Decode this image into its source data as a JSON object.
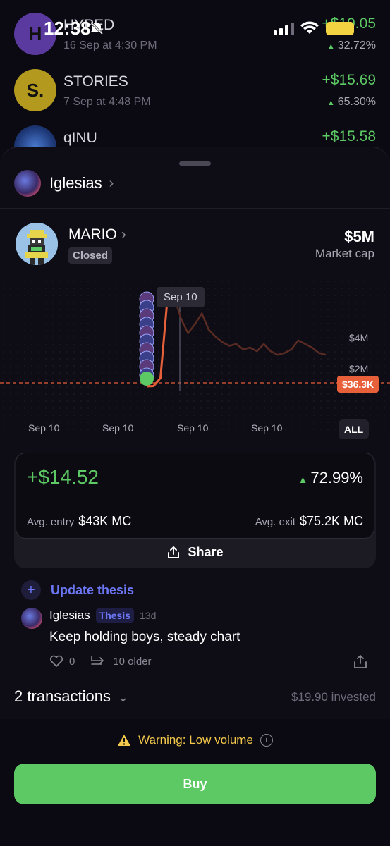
{
  "status_bar": {
    "time": "12:38"
  },
  "background_list": [
    {
      "name": "HYPED",
      "date": "16 Sep at 4:30 PM",
      "amount": "+$19.05",
      "pct": "32.72%",
      "avatar_text": "H",
      "avatar_color": "#5b3aa0"
    },
    {
      "name": "STORIES",
      "date": "7 Sep at 4:48 PM",
      "amount": "+$15.69",
      "pct": "65.30%",
      "avatar_text": "S.",
      "avatar_color": "#b39a1e"
    },
    {
      "name": "qINU",
      "date": "",
      "amount": "+$15.58",
      "pct": "",
      "avatar_text": "",
      "avatar_color": "#1f3a7a"
    }
  ],
  "user": {
    "name": "Iglesias"
  },
  "token": {
    "name": "MARIO",
    "status": "Closed",
    "market_cap": "$5M",
    "market_cap_label": "Market cap"
  },
  "chart_data": {
    "type": "line",
    "tooltip": "Sep 10",
    "x_labels": [
      "Sep 10",
      "Sep 10",
      "Sep 10",
      "Sep 10"
    ],
    "y_labels": [
      "$4M",
      "$2M"
    ],
    "current_price_tag": "$36.3K",
    "range_button": "ALL",
    "series": [
      {
        "values": [
          0.04,
          0.06,
          0.5,
          4.9,
          5.0,
          3.8,
          3.0,
          3.5,
          4.1,
          3.2,
          2.8,
          2.5,
          2.3,
          2.4,
          2.1,
          2.2,
          2.0,
          2.4,
          2.0,
          1.8,
          1.9,
          2.1,
          2.6,
          2.4,
          2.2,
          1.9,
          1.8
        ],
        "color": "#e8603a"
      }
    ],
    "ylim": [
      0,
      5.5
    ]
  },
  "pnl": {
    "amount": "+$14.52",
    "pct": "72.99%",
    "avg_entry_label": "Avg. entry",
    "avg_entry_value": "$43K MC",
    "avg_exit_label": "Avg. exit",
    "avg_exit_value": "$75.2K MC",
    "share_label": "Share"
  },
  "thesis": {
    "update_label": "Update thesis",
    "author": "Iglesias",
    "badge": "Thesis",
    "age": "13d",
    "body": "Keep holding boys, steady chart",
    "likes": "0",
    "older": "10 older"
  },
  "transactions": {
    "label": "2 transactions",
    "invested": "$19.90 invested"
  },
  "warning": {
    "text": "Warning: Low volume"
  },
  "buy": {
    "label": "Buy"
  },
  "colors": {
    "accent_green": "#5cc964",
    "accent_purple": "#6c77f5",
    "accent_orange": "#e8603a",
    "warning_yellow": "#f4c94b"
  }
}
